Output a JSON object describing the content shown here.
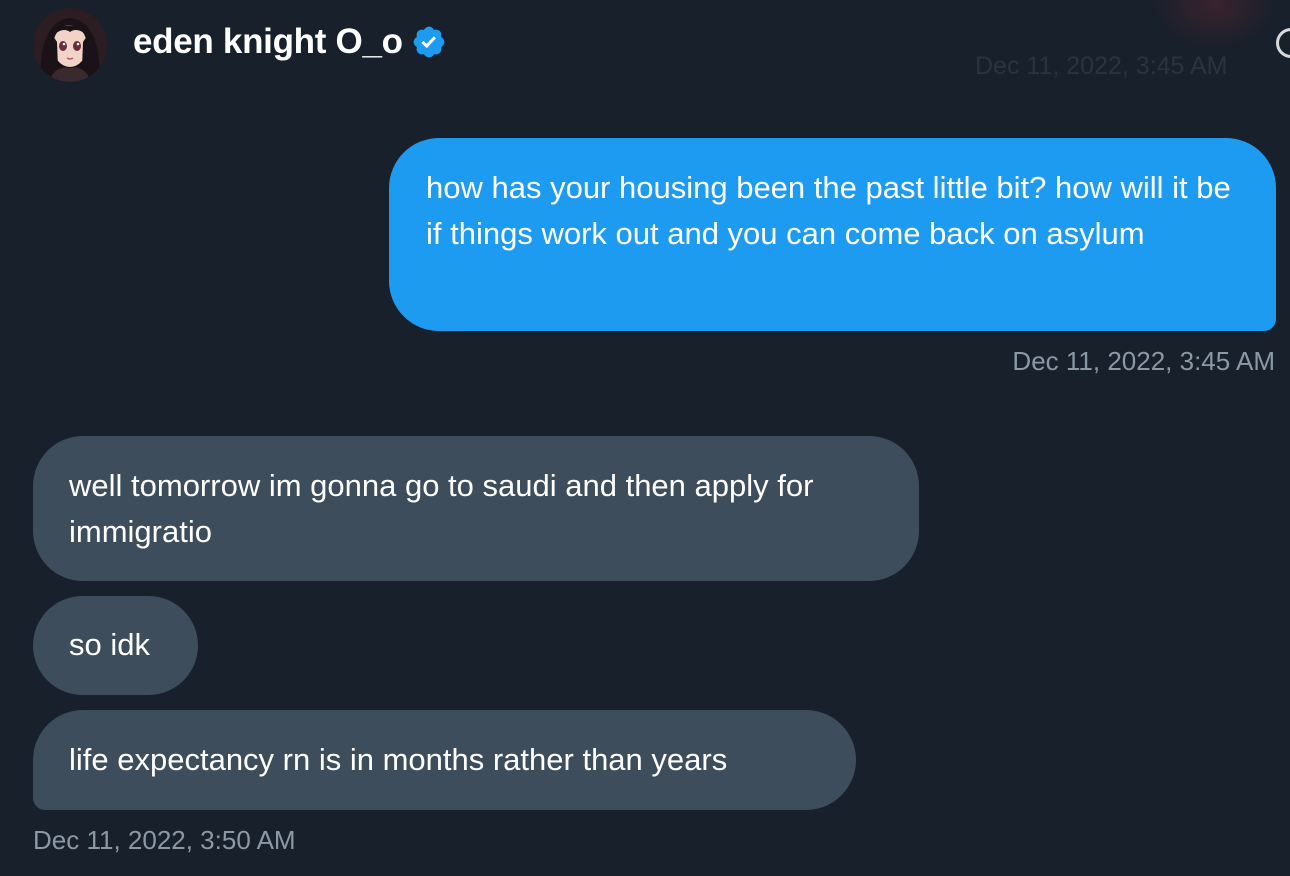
{
  "header": {
    "name": "eden knight O_o",
    "verified": true,
    "avatar_icon": "avatar-anime-portrait",
    "info_icon": "info-icon",
    "faded_timestamp": "Dec 11, 2022, 3:45 AM"
  },
  "messages": [
    {
      "direction": "sent",
      "text": "how has your housing been the past little bit? how will it be if things work out and you can come back on asylum"
    },
    {
      "direction": "received",
      "text": "well tomorrow im gonna go to saudi and then apply for immigratio"
    },
    {
      "direction": "received",
      "text": "so idk"
    },
    {
      "direction": "received",
      "text": "life expectancy rn is in months rather than years"
    }
  ],
  "timestamps": {
    "sent": "Dec 11, 2022, 3:45 AM",
    "received": "Dec 11, 2022, 3:50 AM"
  },
  "colors": {
    "background": "#17202b",
    "sent_bubble": "#1d9bf0",
    "received_bubble": "#3d4d5c",
    "timestamp_text": "#8b98a5",
    "verified_badge": "#1d9bf0"
  }
}
